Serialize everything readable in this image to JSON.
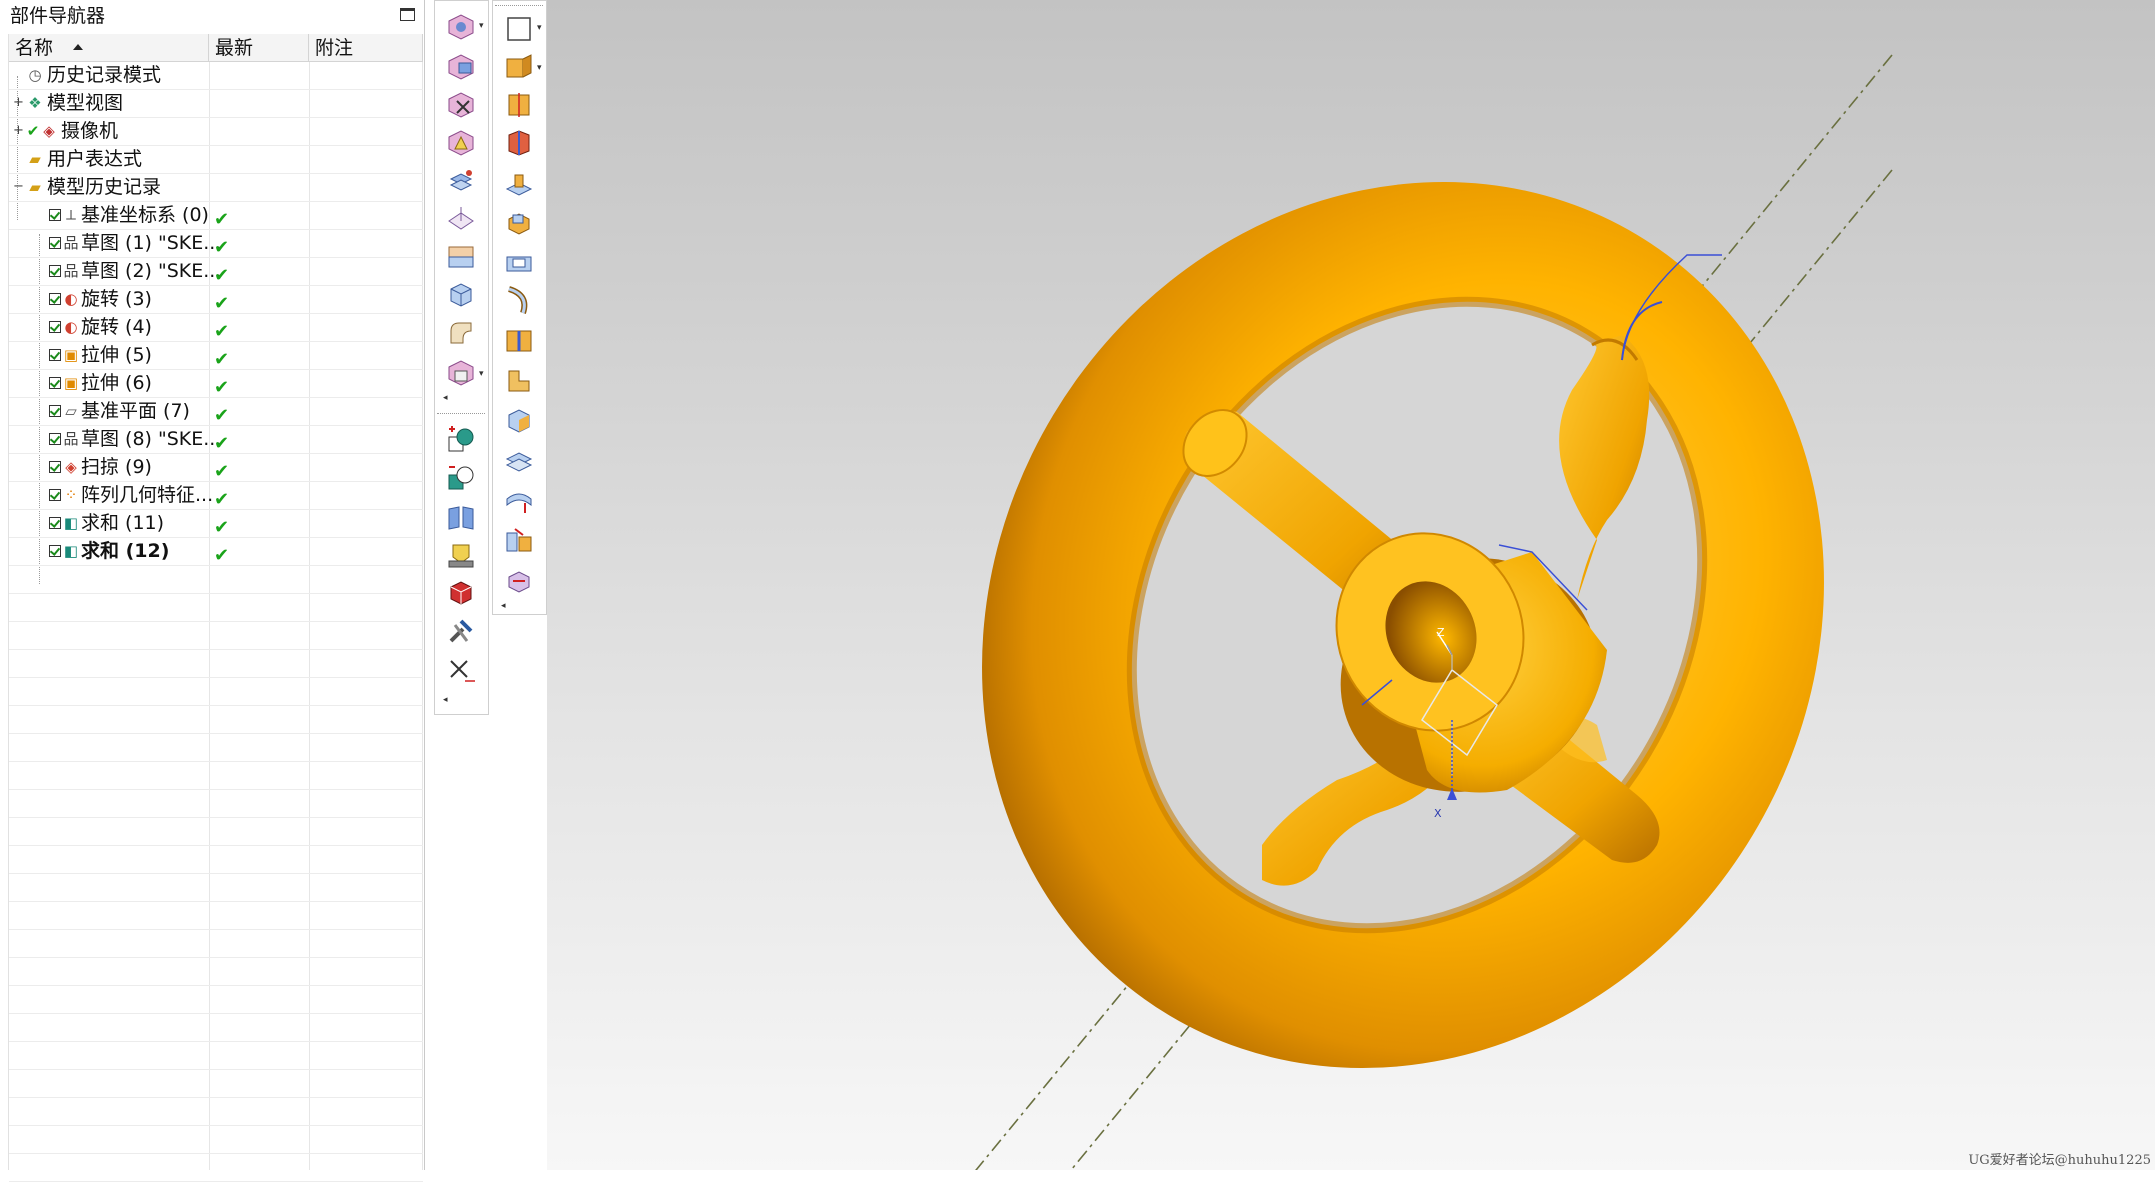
{
  "navigator": {
    "title": "部件导航器",
    "columns": {
      "name": "名称",
      "latest": "最新",
      "notes": "附注"
    },
    "nodes": {
      "history_mode": "历史记录模式",
      "model_views": "模型视图",
      "cameras": "摄像机",
      "user_expressions": "用户表达式",
      "model_history": "模型历史记录"
    },
    "features": [
      {
        "label": "基准坐标系 (0)",
        "icon": "datum-csys-icon",
        "latest": "✔"
      },
      {
        "label": "草图 (1) \"SKE...",
        "icon": "sketch-icon",
        "latest": "✔"
      },
      {
        "label": "草图 (2) \"SKE...",
        "icon": "sketch-icon",
        "latest": "✔"
      },
      {
        "label": "旋转 (3)",
        "icon": "revolve-icon",
        "latest": "✔"
      },
      {
        "label": "旋转 (4)",
        "icon": "revolve-icon",
        "latest": "✔"
      },
      {
        "label": "拉伸 (5)",
        "icon": "extrude-icon",
        "latest": "✔"
      },
      {
        "label": "拉伸 (6)",
        "icon": "extrude-icon",
        "latest": "✔"
      },
      {
        "label": "基准平面 (7)",
        "icon": "datum-plane-icon",
        "latest": "✔"
      },
      {
        "label": "草图 (8) \"SKE...",
        "icon": "sketch-icon",
        "latest": "✔"
      },
      {
        "label": "扫掠 (9)",
        "icon": "sweep-icon",
        "latest": "✔"
      },
      {
        "label": "阵列几何特征...",
        "icon": "pattern-icon",
        "latest": "✔"
      },
      {
        "label": "求和 (11)",
        "icon": "unite-icon",
        "latest": "✔"
      },
      {
        "label": "求和 (12)",
        "icon": "unite-icon",
        "latest": "✔"
      }
    ]
  },
  "viewport": {
    "model_color": "#ffb300",
    "background_top": "#c3c3c3",
    "background_bottom": "#f7f7f7",
    "axis_labels": {
      "z": "Z",
      "x": "X"
    },
    "watermark": "UG爱好者论坛@huhuhu1225"
  },
  "colors": {
    "check_green": "#1aa31a",
    "edge_blue": "#3a4fd6"
  }
}
